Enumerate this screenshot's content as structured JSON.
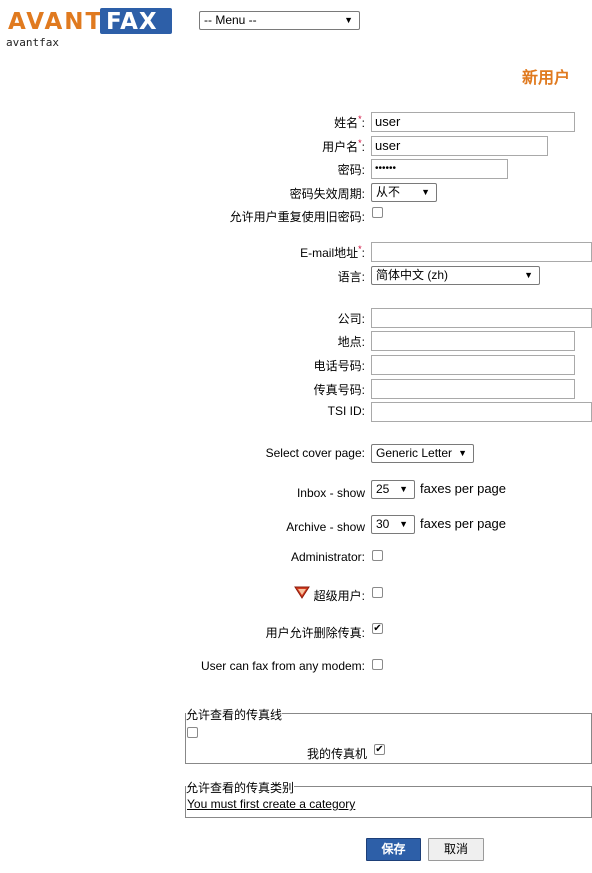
{
  "header": {
    "logo_avant": "AVANT",
    "logo_fax": "FAX",
    "caption": "avantfax",
    "menu_select": "-- Menu --"
  },
  "page_title": "新用户",
  "form": {
    "name_label": "姓名",
    "name_value": "user",
    "username_label": "用户名",
    "username_value": "user",
    "password_label": "密码:",
    "password_value": "••••••",
    "expiry_label": "密码失效周期:",
    "expiry_value": "从不",
    "reuse_label": "允许用户重复使用旧密码:",
    "email_label": "E-mail地址",
    "email_value": "",
    "language_label": "语言:",
    "language_value": "简体中文 (zh)",
    "company_label": "公司:",
    "location_label": "地点:",
    "phone_label": "电话号码:",
    "fax_label": "传真号码:",
    "tsi_label": "TSI ID:",
    "cover_label": "Select cover page:",
    "cover_value": "Generic Letter",
    "inbox_label": "Inbox - show",
    "inbox_value": "25",
    "inbox_suffix": "faxes per page",
    "archive_label": "Archive - show",
    "archive_value": "30",
    "archive_suffix": "faxes per page",
    "admin_label": "Administrator:",
    "superuser_label": "超级用户:",
    "delete_label": "用户允许删除传真:",
    "anymodem_label": "User can fax from any modem:"
  },
  "fax_lines": {
    "legend": "允许查看的传真线",
    "my_fax_label": "我的传真机"
  },
  "categories": {
    "legend": "允许查看的传真类别",
    "link": "You must first create a category"
  },
  "buttons": {
    "save": "保存",
    "cancel": "取消"
  },
  "colors": {
    "brand_orange": "#e07a1f",
    "brand_blue": "#2d5fa8"
  }
}
